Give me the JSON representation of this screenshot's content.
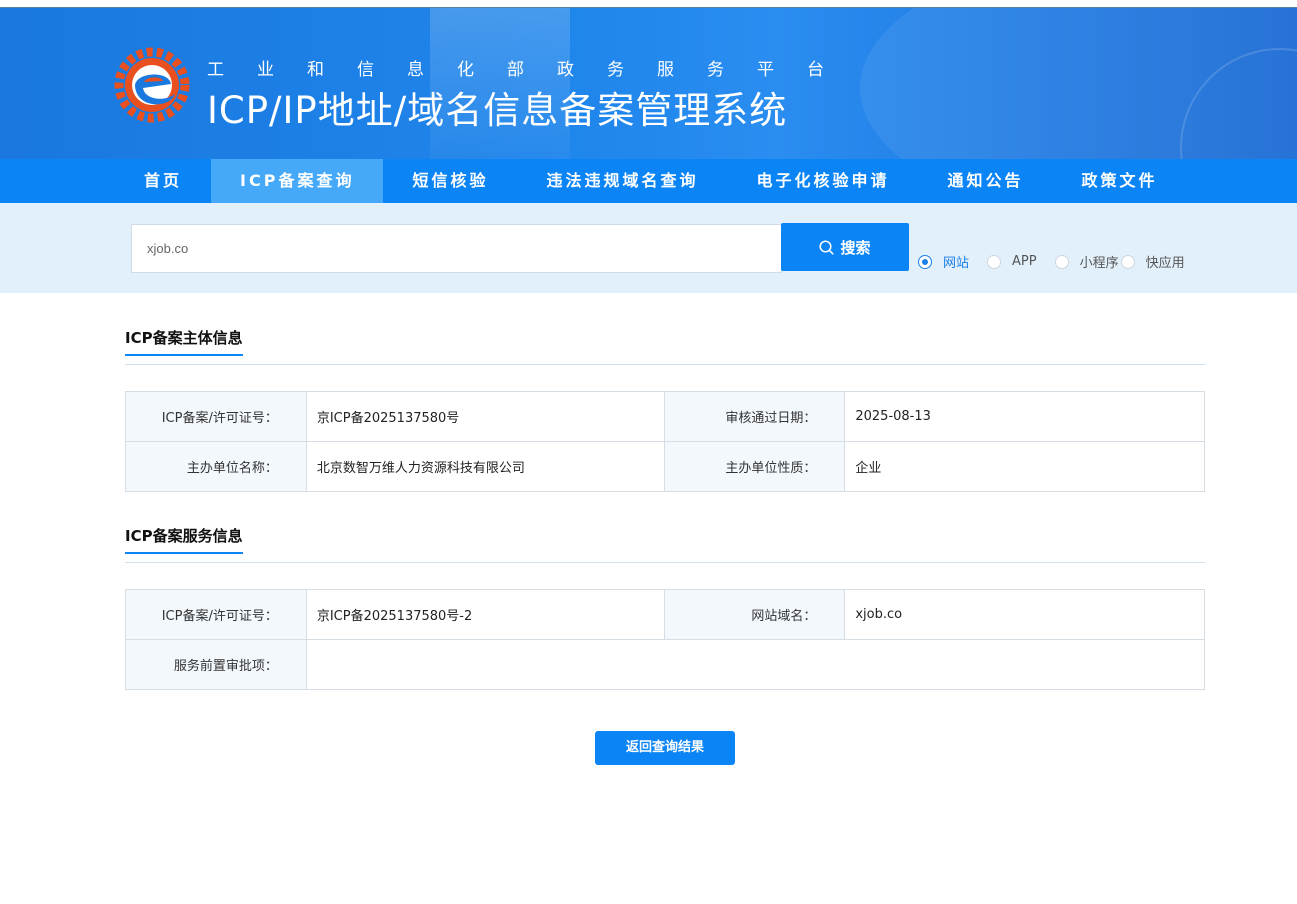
{
  "banner": {
    "subtitle": "工业和信息化部政务服务平台",
    "title": "ICP/IP地址/域名信息备案管理系统"
  },
  "nav": {
    "items": [
      "首页",
      "ICP备案查询",
      "短信核验",
      "违法违规域名查询",
      "电子化核验申请",
      "通知公告",
      "政策文件"
    ],
    "active": "ICP备案查询"
  },
  "search": {
    "value": "xjob.co",
    "button_label": "搜索",
    "options": [
      "网站",
      "APP",
      "小程序",
      "快应用"
    ],
    "selected": "网站"
  },
  "subject_info": {
    "title": "ICP备案主体信息",
    "license_label": "ICP备案/许可证号：",
    "license_value": "京ICP备2025137580号",
    "approval_date_label": "审核通过日期：",
    "approval_date_value": "2025-08-13",
    "org_name_label": "主办单位名称：",
    "org_name_value": "北京数智万维人力资源科技有限公司",
    "org_type_label": "主办单位性质：",
    "org_type_value": "企业"
  },
  "service_info": {
    "title": "ICP备案服务信息",
    "license_label": "ICP备案/许可证号：",
    "license_value": "京ICP备2025137580号-2",
    "domain_label": "网站域名：",
    "domain_value": "xjob.co",
    "pre_approval_label": "服务前置审批项：",
    "pre_approval_value": ""
  },
  "actions": {
    "back_label": "返回查询结果"
  },
  "colors": {
    "primary": "#0b84f5",
    "nav_active": "#45a8f8",
    "search_bg": "#e2f0fc",
    "label_bg": "#f3f8fd"
  }
}
